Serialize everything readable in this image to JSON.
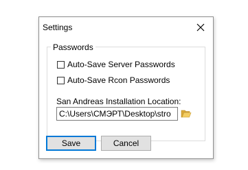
{
  "window": {
    "title": "Settings",
    "close_label": "close"
  },
  "passwords_group": {
    "legend": "Passwords",
    "options": [
      {
        "label": "Auto-Save Server Passwords",
        "checked": false
      },
      {
        "label": "Auto-Save Rcon Passwords",
        "checked": false
      }
    ]
  },
  "install_location": {
    "label": "San Andreas Installation Location:",
    "value": "C:\\Users\\СМЭРТ\\Desktop\\stro"
  },
  "buttons": {
    "save_label": "Save",
    "cancel_label": "Cancel"
  },
  "colors": {
    "accent": "#0078d7",
    "folder_icon": "#e8b84a"
  }
}
